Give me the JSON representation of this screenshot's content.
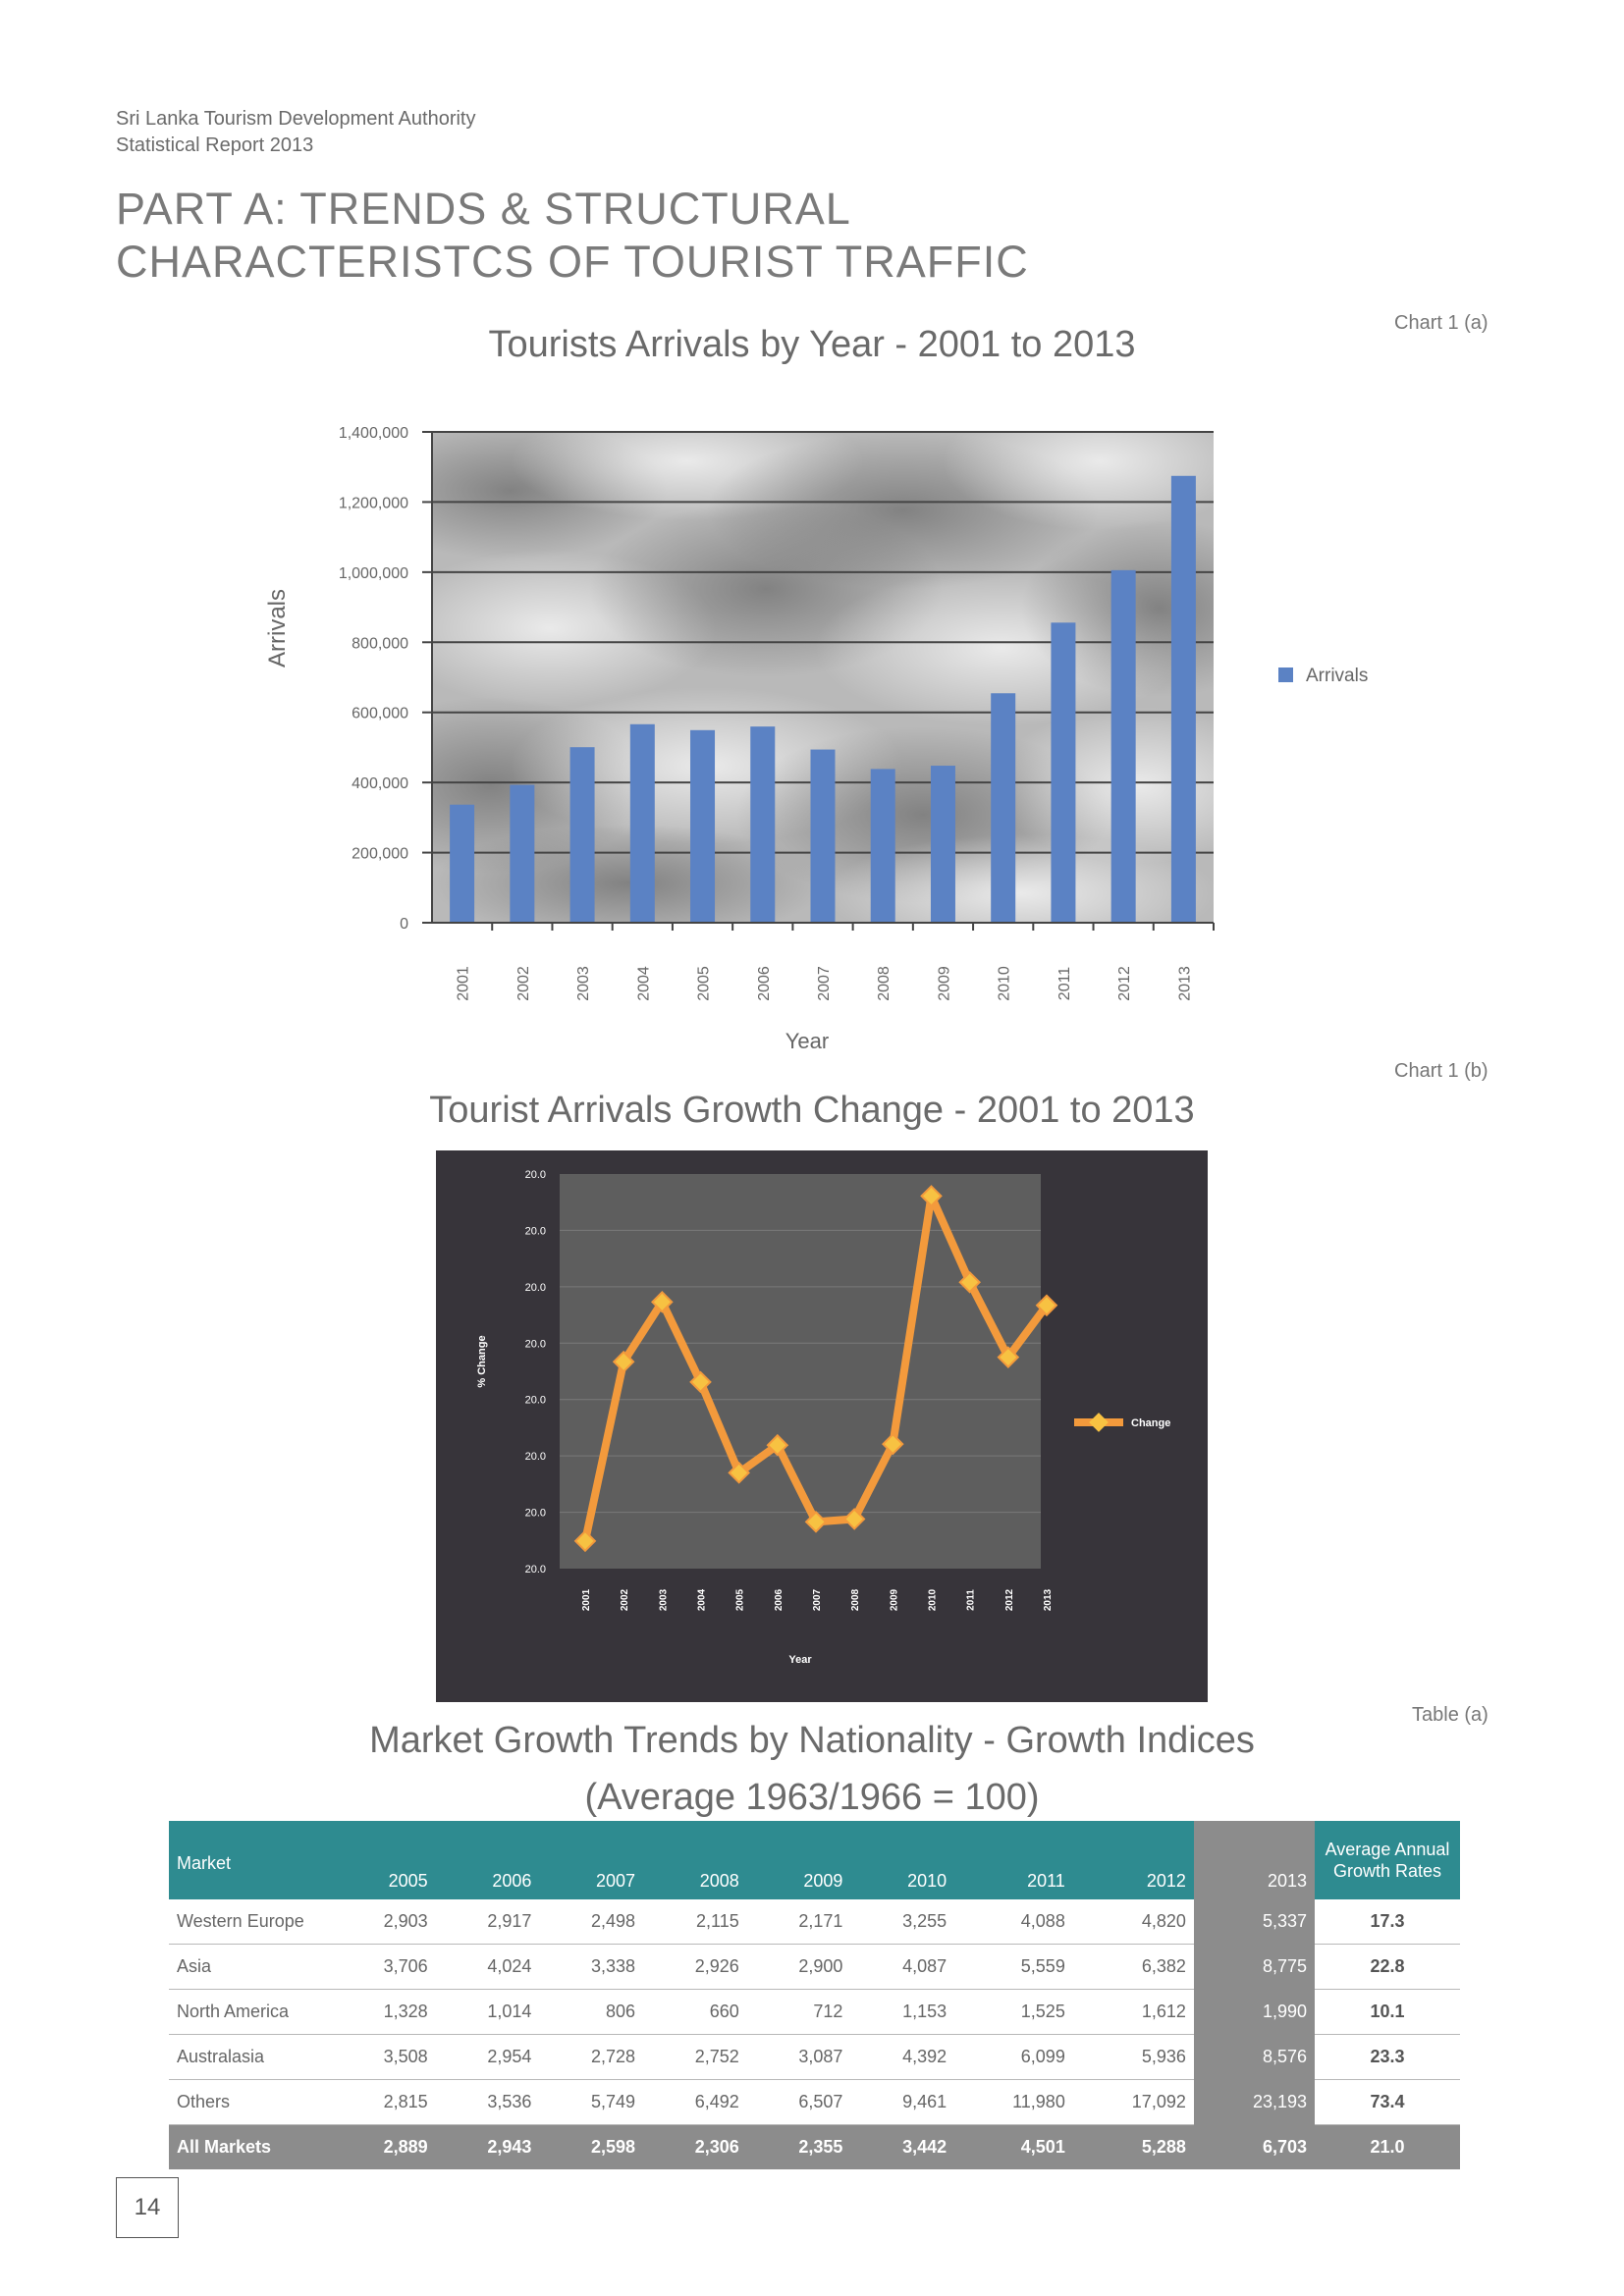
{
  "header": {
    "org": "Sri Lanka Tourism Development Authority",
    "report": "Statistical Report 2013"
  },
  "part_title": {
    "line1": "PART A: TRENDS & STRUCTURAL",
    "line2": "CHARACTERISTCS OF TOURIST TRAFFIC"
  },
  "chart_a": {
    "tag": "Chart 1 (a)"
  },
  "chart_b": {
    "tag": "Chart 1 (b)"
  },
  "table_a": {
    "tag": "Table (a)",
    "title_line1": "Market Growth Trends by Nationality - Growth Indices",
    "title_line2": "(Average 1963/1966 = 100)",
    "col_market": "Market",
    "years": [
      "2005",
      "2006",
      "2007",
      "2008",
      "2009",
      "2010",
      "2011",
      "2012",
      "2013"
    ],
    "col_avg_line1": "Average Annual",
    "col_avg_line2": "Growth Rates",
    "rows": [
      {
        "market": "Western Europe",
        "values": [
          "2,903",
          "2,917",
          "2,498",
          "2,115",
          "2,171",
          "3,255",
          "4,088",
          "4,820",
          "5,337"
        ],
        "avg": "17.3"
      },
      {
        "market": "Asia",
        "values": [
          "3,706",
          "4,024",
          "3,338",
          "2,926",
          "2,900",
          "4,087",
          "5,559",
          "6,382",
          "8,775"
        ],
        "avg": "22.8"
      },
      {
        "market": "North America",
        "values": [
          "1,328",
          "1,014",
          "806",
          "660",
          "712",
          "1,153",
          "1,525",
          "1,612",
          "1,990"
        ],
        "avg": "10.1"
      },
      {
        "market": "Australasia",
        "values": [
          "3,508",
          "2,954",
          "2,728",
          "2,752",
          "3,087",
          "4,392",
          "6,099",
          "5,936",
          "8,576"
        ],
        "avg": "23.3"
      },
      {
        "market": "Others",
        "values": [
          "2,815",
          "3,536",
          "5,749",
          "6,492",
          "6,507",
          "9,461",
          "11,980",
          "17,092",
          "23,193"
        ],
        "avg": "73.4"
      }
    ],
    "total": {
      "market": "All Markets",
      "values": [
        "2,889",
        "2,943",
        "2,598",
        "2,306",
        "2,355",
        "3,442",
        "4,501",
        "5,288",
        "6,703"
      ],
      "avg": "21.0"
    }
  },
  "page_number": "14",
  "colors": {
    "bar": "#5b82c4",
    "line": "#f39a3c",
    "table_header": "#2e8b90",
    "table_2013": "#8c8c8c"
  },
  "chart_data": [
    {
      "type": "bar",
      "title": "Tourists Arrivals by Year - 2001 to 2013",
      "xlabel": "Year",
      "ylabel": "Arrivals",
      "categories": [
        "2001",
        "2002",
        "2003",
        "2004",
        "2005",
        "2006",
        "2007",
        "2008",
        "2009",
        "2010",
        "2011",
        "2012",
        "2013"
      ],
      "series": [
        {
          "name": "Arrivals",
          "values": [
            336794,
            393171,
            500642,
            566202,
            549308,
            559603,
            494008,
            438475,
            447890,
            654476,
            855975,
            1005605,
            1274593
          ]
        }
      ],
      "ylim": [
        0,
        1400000
      ],
      "yticks": [
        "0",
        "200,000",
        "400,000",
        "600,000",
        "800,000",
        "1,000,000",
        "1,200,000",
        "1,400,000"
      ],
      "grid": true,
      "legend": "right"
    },
    {
      "type": "line",
      "title": "Tourist Arrivals Growth Change - 2001 to 2013",
      "xlabel": "Year",
      "ylabel": "% Change",
      "categories": [
        "2001",
        "2002",
        "2003",
        "2004",
        "2005",
        "2006",
        "2007",
        "2008",
        "2009",
        "2010",
        "2011",
        "2012",
        "2013"
      ],
      "series": [
        {
          "name": "Change",
          "values": [
            -15.1,
            16.7,
            27.3,
            13.1,
            -3.0,
            1.9,
            -11.7,
            -11.2,
            2.1,
            46.1,
            30.8,
            17.5,
            26.7
          ]
        }
      ],
      "ylim": [
        -20,
        50
      ],
      "yticks": [
        "20.0",
        "20.0",
        "20.0",
        "20.0",
        "20.0",
        "20.0",
        "20.0",
        "20.0"
      ],
      "grid": true,
      "legend": "right"
    }
  ]
}
